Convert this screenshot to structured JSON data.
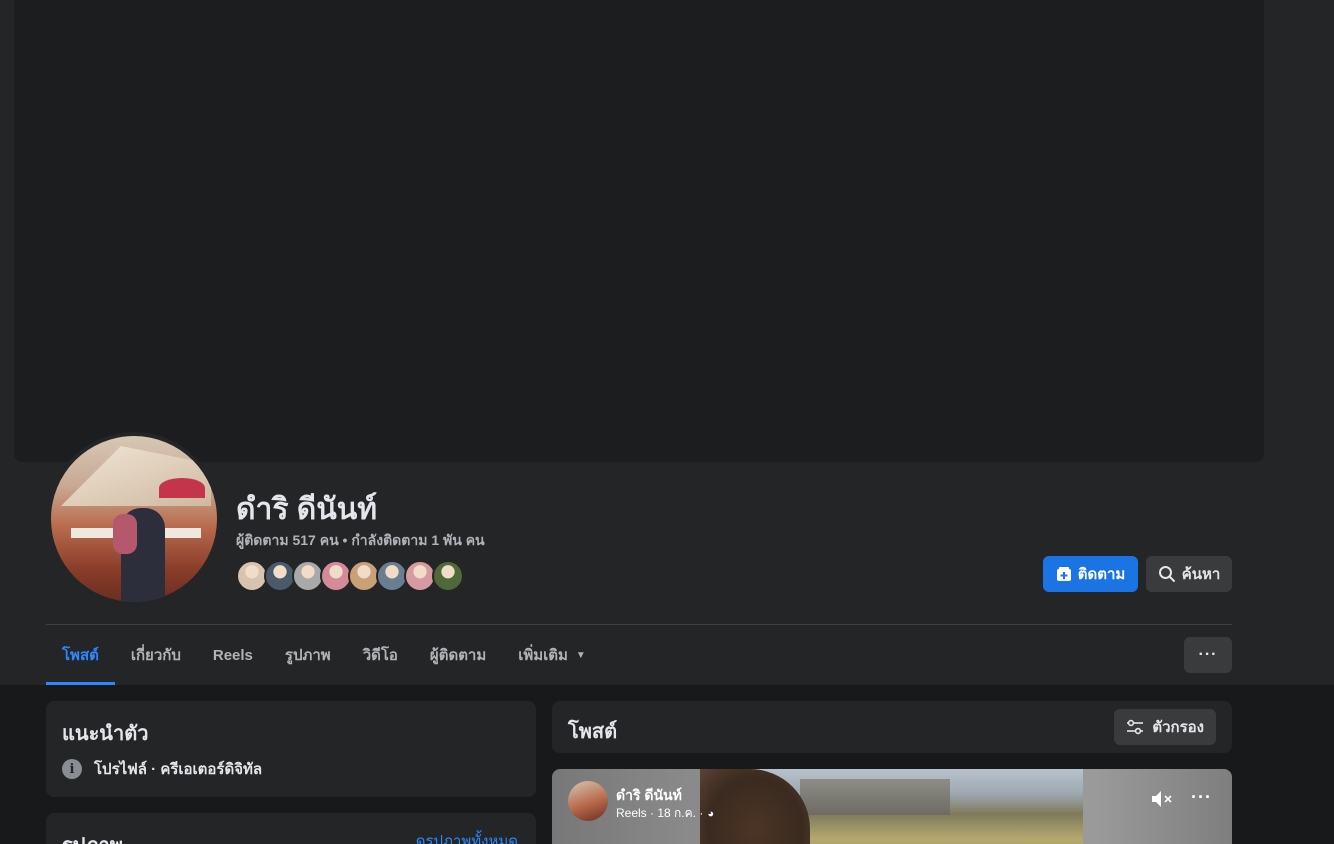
{
  "profile": {
    "name": "ดำริ ดีนันท์",
    "stats": "ผู้ติดตาม 517 คน • กำลังติดตาม 1 พัน คน",
    "friend_avatar_colors": [
      "#d8c2b0",
      "#4a5a6b",
      "#a9a9a9",
      "#d58a9a",
      "#caa078",
      "#6a7e92",
      "#d69aa0",
      "#4e6a3a"
    ]
  },
  "actions": {
    "follow_label": "ติดตาม",
    "search_label": "ค้นหา"
  },
  "tabs": [
    {
      "label": "โพสต์",
      "active": true
    },
    {
      "label": "เกี่ยวกับ"
    },
    {
      "label": "Reels"
    },
    {
      "label": "รูปภาพ"
    },
    {
      "label": "วิดีโอ"
    },
    {
      "label": "ผู้ติดตาม"
    },
    {
      "label": "เพิ่มเติม"
    }
  ],
  "more_button_label": "···",
  "intro": {
    "title": "แนะนำตัว",
    "detail": "โปรไฟล์ · ครีเอเตอร์ดิจิทัล"
  },
  "photos": {
    "title": "รูปภาพ",
    "see_all": "ดูรูปภาพทั้งหมด"
  },
  "posts": {
    "title": "โพสต์",
    "filter_label": "ตัวกรอง"
  },
  "reel_post": {
    "author": "ดำริ ดีนันท์",
    "meta": "Reels · 18 ก.ค. ·",
    "more_label": "···"
  },
  "colors": {
    "accent": "#2d88ff",
    "button_primary": "#1b74e4",
    "surface": "#242526",
    "background": "#18191a"
  }
}
